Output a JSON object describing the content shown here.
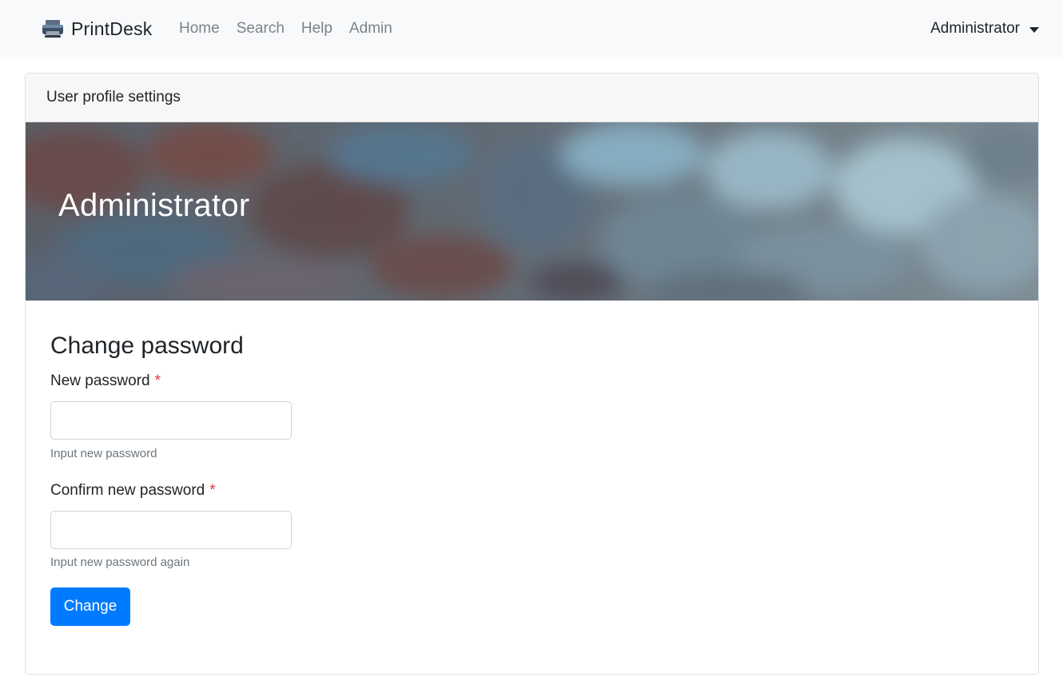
{
  "navbar": {
    "brand": "PrintDesk",
    "brand_icon": "printer-icon",
    "links": [
      "Home",
      "Search",
      "Help",
      "Admin"
    ],
    "user": "Administrator"
  },
  "card": {
    "header": "User profile settings",
    "banner_title": "Administrator"
  },
  "form": {
    "title": "Change password",
    "new_password_label": "New password",
    "new_password_help": "Input new password",
    "confirm_password_label": "Confirm new password",
    "confirm_password_help": "Input new password again",
    "required_marker": "*",
    "submit_label": "Change"
  },
  "colors": {
    "primary": "#007bff",
    "required": "#dc3545",
    "navbar_bg": "#f8f9fa"
  }
}
